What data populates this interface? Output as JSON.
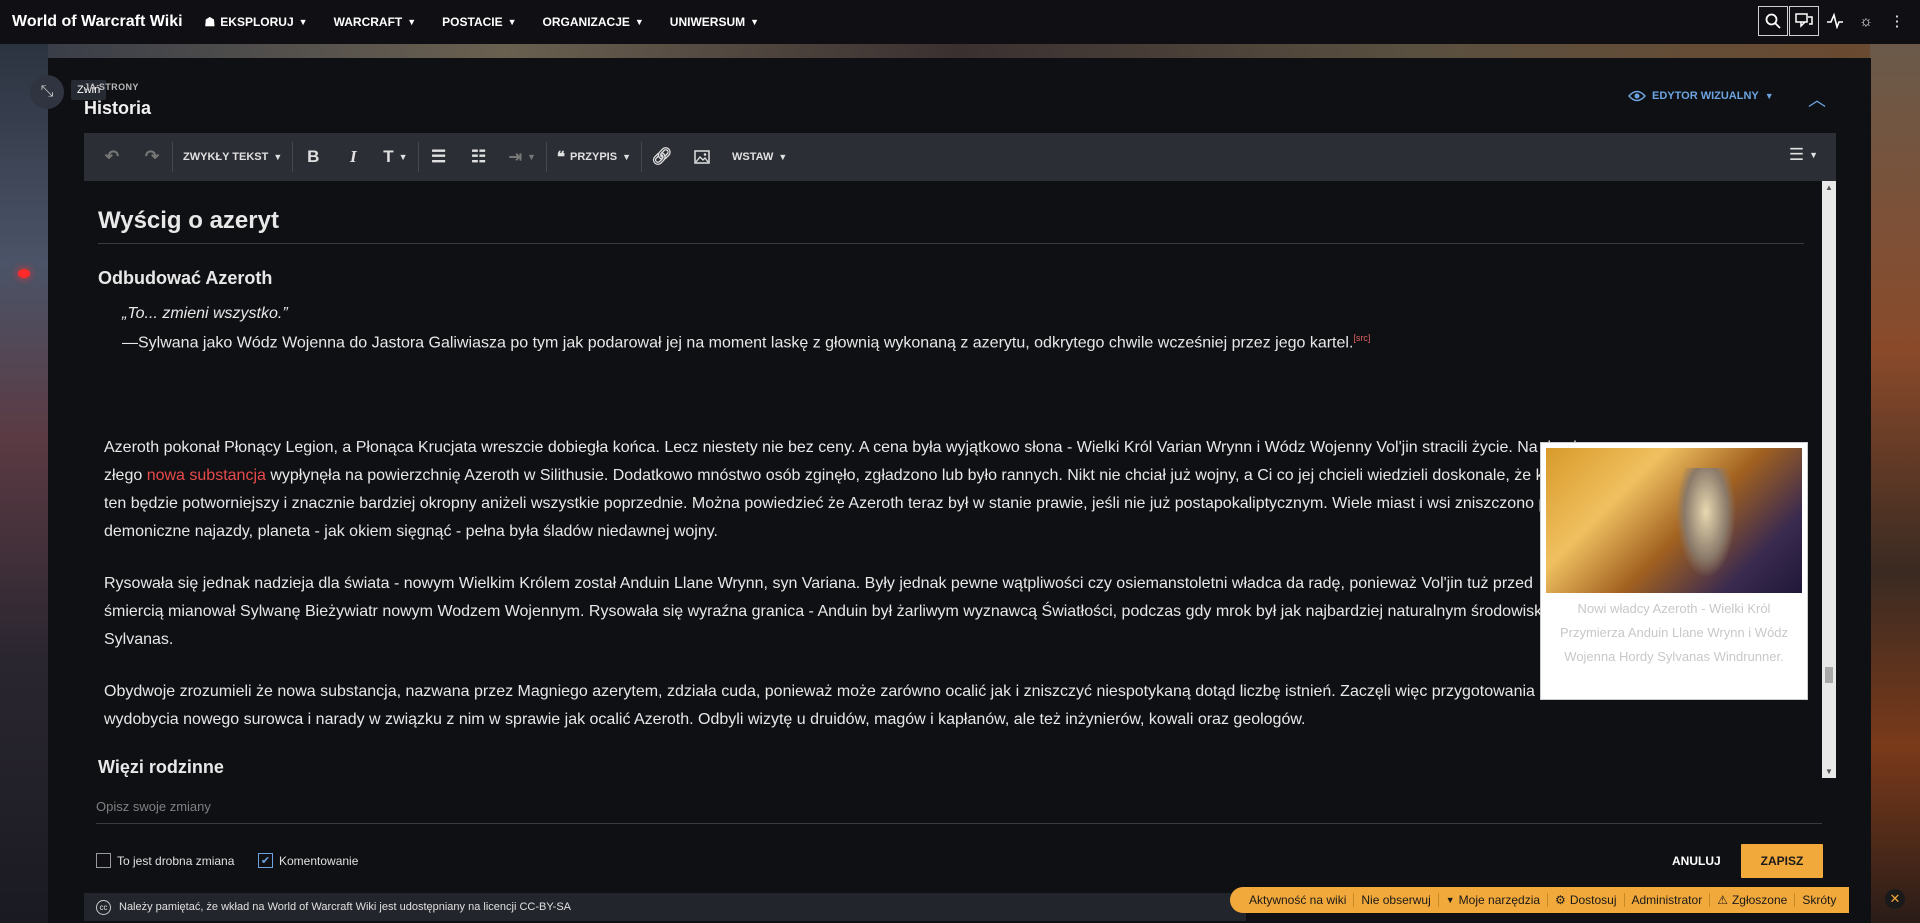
{
  "site": {
    "title": "World of Warcraft Wiki"
  },
  "nav": {
    "items": [
      "EKSPLORUJ",
      "WARCRAFT",
      "POSTACIE",
      "ORGANIZACJE",
      "UNIWERSUM"
    ]
  },
  "editor_header": {
    "collapse_tooltip": "Zwiń",
    "edit_label": "JA STRONY",
    "page_title": "Historia",
    "mode_label": "EDYTOR WIZUALNY"
  },
  "toolbar": {
    "paragraph_format": "ZWYKŁY TEKST",
    "cite": "PRZYPIS",
    "insert": "WSTAW"
  },
  "content": {
    "heading": "Wyścig o azeryt",
    "subheading": "Odbudować Azeroth",
    "quote": "„To... zmieni wszystko.”",
    "quote_source": "—Sylwana jako Wódz Wojenna do Jastora Galiwiasza po tym jak podarował jej na moment laskę z głownią wykonaną z azerytu, odkrytego chwile wcześniej przez jego kartel.",
    "quote_ref": "[src]",
    "p1_before": "Azeroth pokonał Płonący Legion, a Płonąca Krucjata wreszcie dobiegła końca. Lecz niestety nie bez ceny. A cena była wyjątkowo słona - Wielki Król Varian Wrynn i Wódz Wojenny Vol'jin stracili życie. Na domiar złego ",
    "p1_link": "nowa substancja",
    "p1_after": " wypłynęła na powierzchnię Azeroth w Silithusie. Dodatkowo mnóstwo osób zginęło, zgładzono lub było rannych. Nikt nie chciał już wojny, a Ci co jej chcieli wiedzieli doskonale, że konflikt ten będzie potworniejszy i znacznie bardziej okropny aniżeli wszystkie poprzednie. Można powiedzieć że Azeroth teraz był w stanie prawie, jeśli nie już postapokaliptycznym. Wiele miast i wsi zniszczono przez demoniczne najazdy, planeta - jak okiem sięgnąć - pełna była śladów niedawnej wojny.",
    "p2": "Rysowała się jednak nadzieja dla świata - nowym Wielkim Królem został Anduin Llane Wrynn, syn Variana. Były jednak pewne wątpliwości czy osiemanstoletni władca da radę, ponieważ Vol'jin tuż przed śmiercią mianował Sylwanę Bieżywiatr nowym Wodzem Wojennym. Rysowała się wyraźna granica - Anduin był żarliwym wyznawcą Światłości, podczas gdy mrok był jak najbardziej naturalnym środowiskiem Sylvanas.",
    "p3": "Obydwoje zrozumieli że nowa substancja, nazwana przez Magniego azerytem, zdziała cuda, ponieważ może zarówno ocalić jak i zniszczyć niespotykaną dotąd liczbę istnień. Zaczęli więc przygotowania do wydobycia nowego surowca i narady w związku z nim w sprawie jak ocalić Azeroth. Odbyli wizytę u druidów, magów i kapłanów, ale też inżynierów, kowali oraz geologów.",
    "image_caption": "Nowi władcy Azeroth - Wielki Król Przymierza Anduin Llane Wrynn i Wódz Wojenna Hordy Sylvanas Windrunner.",
    "subheading2": "Więzi rodzinne"
  },
  "footer": {
    "summary_placeholder": "Opisz swoje zmiany",
    "minor_edit": "To jest drobna zmiana",
    "watch": "Komentowanie",
    "cancel": "ANULUJ",
    "save": "ZAPISZ",
    "license": "Należy pamiętać, że wkład na World of Warcraft Wiki jest udostępniany na licencji CC-BY-SA"
  },
  "wikibar": {
    "items": [
      "Aktywność na wiki",
      "Nie obserwuj",
      "Moje narzędzia",
      "Dostosuj",
      "Administrator",
      "Zgłoszone",
      "Skróty"
    ]
  },
  "colors": {
    "accent": "#f2a93b",
    "link_blue": "#6da4e0",
    "red_link": "#e84a4a"
  }
}
